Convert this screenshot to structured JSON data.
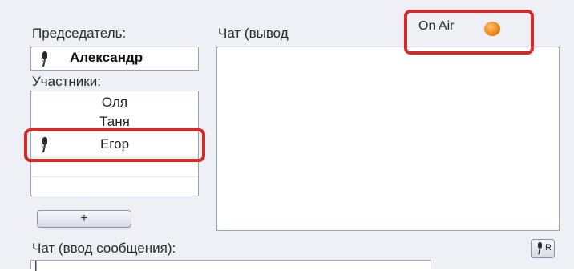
{
  "chairman": {
    "label": "Председатель:",
    "name": "Александр"
  },
  "participants": {
    "label": "Участники:",
    "items": [
      "Оля",
      "Таня",
      "Егор"
    ]
  },
  "chat_output": {
    "label": "Чат (вывод"
  },
  "on_air": {
    "label": "On Air",
    "indicator_color": "#f08a1c"
  },
  "add_button": {
    "label": "+"
  },
  "chat_input": {
    "label": "Чат (ввод сообщения):",
    "value": "|"
  },
  "mic_r_button": {
    "label": "R"
  },
  "colors": {
    "highlight": "#d32a2a",
    "panel": "#eef0f6",
    "border": "#9aa3b4"
  }
}
